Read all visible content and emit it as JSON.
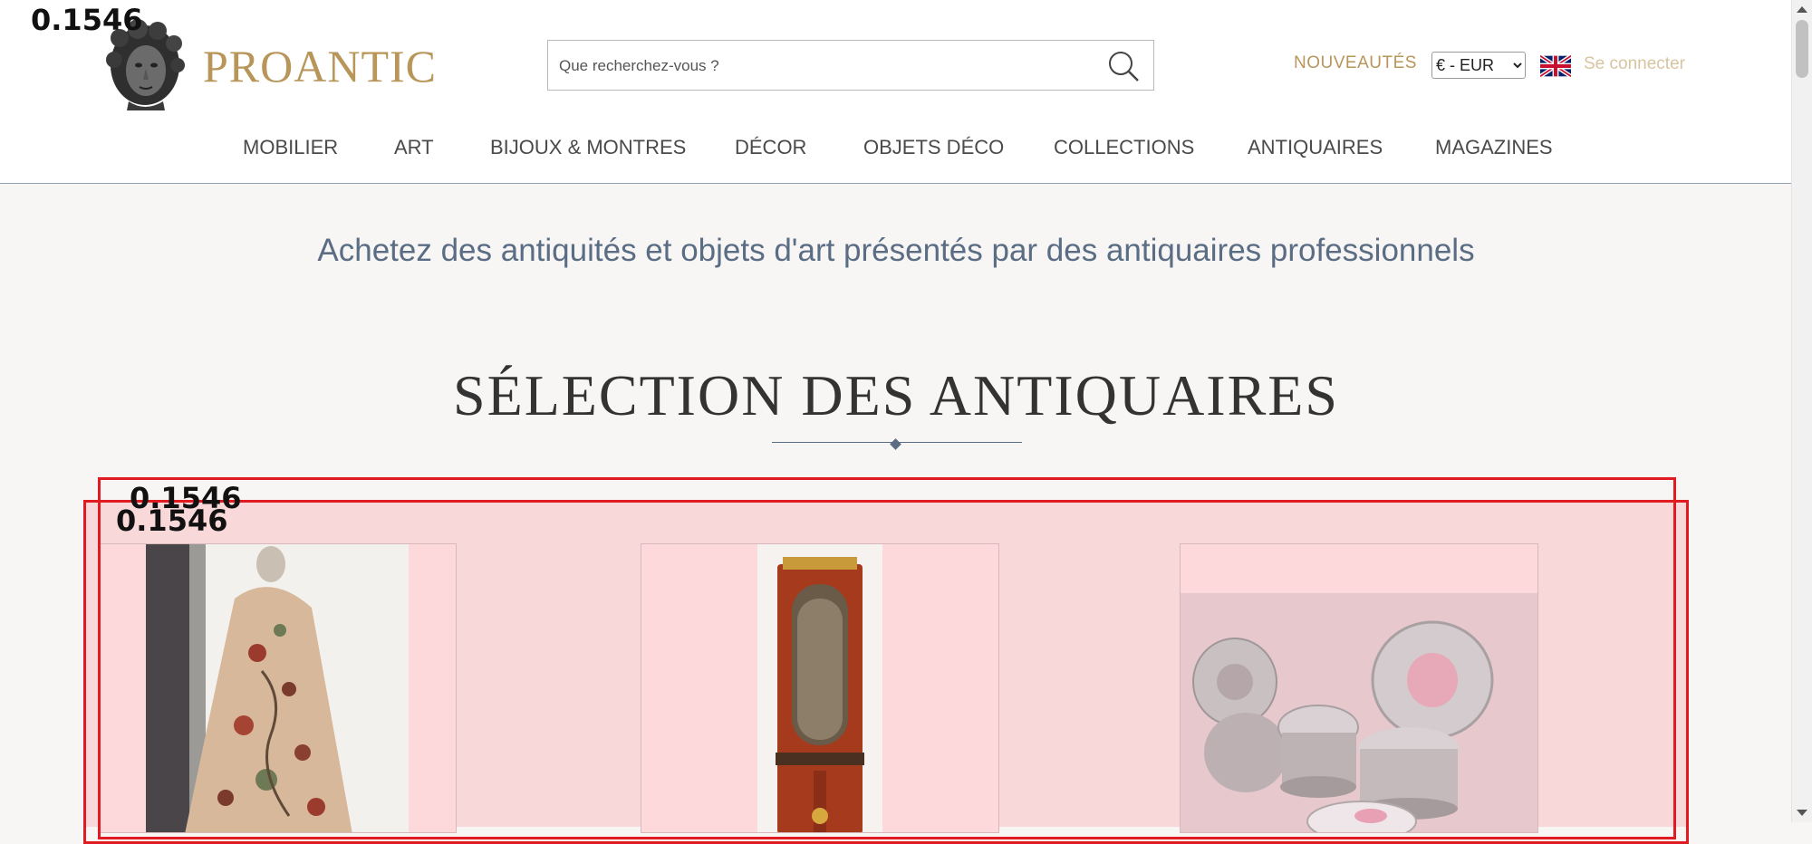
{
  "overlay_score": "0.1546",
  "header": {
    "logo_text": "PROANTIC",
    "search_placeholder": "Que recherchez-vous ?",
    "nouveautes_label": "NOUVEAUTÉS",
    "currency_selected": "€ - EUR",
    "login_label": "Se connecter",
    "flag_icon": "uk-flag-icon"
  },
  "nav": {
    "items": [
      "MOBILIER",
      "ART",
      "BIJOUX & MONTRES",
      "DÉCOR",
      "OBJETS DÉCO",
      "COLLECTIONS",
      "ANTIQUAIRES",
      "MAGAZINES"
    ]
  },
  "main": {
    "tagline": "Achetez des antiquités et objets d'art présentés par des antiquaires professionnels",
    "section_title": "SÉLECTION DES ANTIQUAIRES"
  },
  "colors": {
    "brand_gold": "#b8965a",
    "slate_blue": "#5a6d84",
    "overlay_red": "#e11b22",
    "highlight_pink": "#f9d8da"
  }
}
